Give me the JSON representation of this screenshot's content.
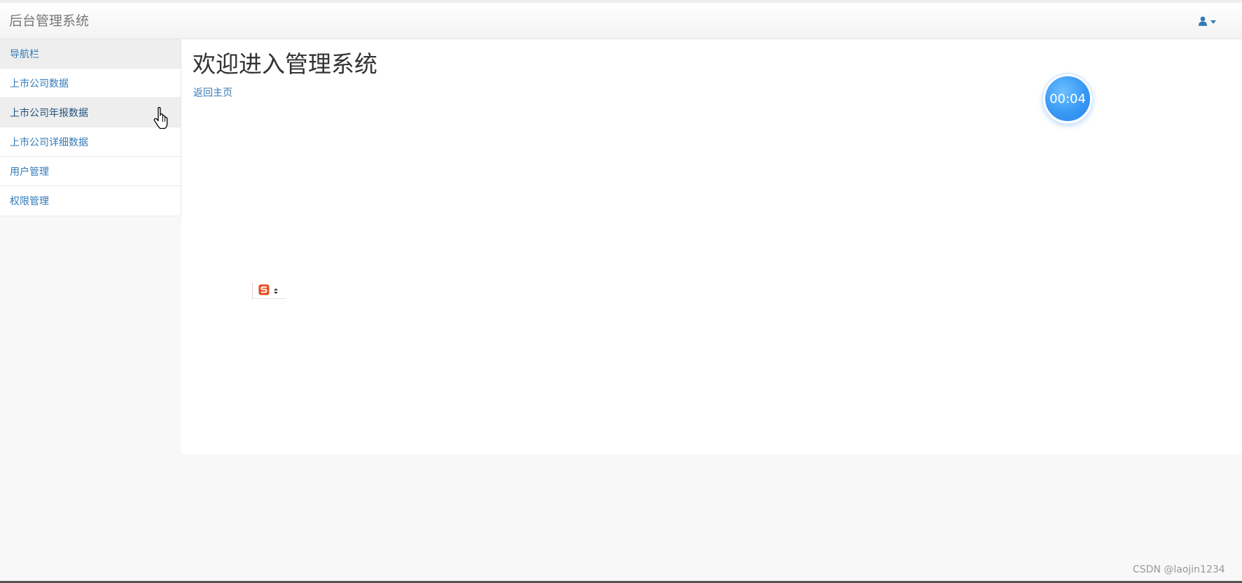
{
  "navbar": {
    "brand": "后台管理系统",
    "user_icon": "user-icon",
    "caret_icon": "caret-down-icon"
  },
  "sidebar": {
    "items": [
      {
        "label": "导航栏"
      },
      {
        "label": "上市公司数据"
      },
      {
        "label": "上市公司年报数据"
      },
      {
        "label": "上市公司详细数据"
      },
      {
        "label": "用户管理"
      },
      {
        "label": "权限管理"
      }
    ]
  },
  "main": {
    "title": "欢迎进入管理系统",
    "home_link": "返回主页"
  },
  "timer": {
    "value": "00:04"
  },
  "ime": {
    "icon": "sogou-ime-icon"
  },
  "watermark": "CSDN @laojin1234",
  "colors": {
    "link": "#337ab7",
    "timer": "#3798f5",
    "ime_logo": "#e8491d"
  }
}
